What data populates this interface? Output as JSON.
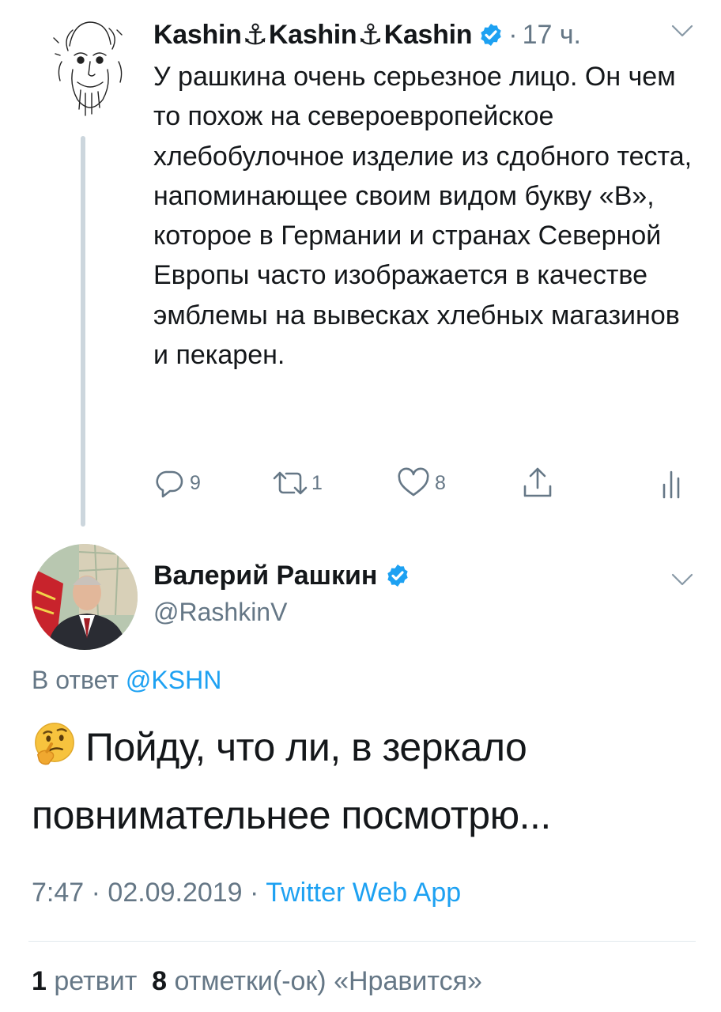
{
  "parent_tweet": {
    "author_name": "Kashin",
    "anchor_glyph": "⚓",
    "time": "17 ч.",
    "text": "У рашкина очень серьезное лицо. Он чем то похож на североевропейское хлебобулочное изделие из сдобного теста, напоминающее своим видом букву «В», которое в Германии и странах Северной Европы часто изображается в качестве эмблемы на вывесках хлебных магазинов и пекарен.",
    "replies_count": "9",
    "retweets_count": "1",
    "likes_count": "8"
  },
  "reply_tweet": {
    "author_name": "Валерий Рашкин",
    "handle": "@RashkinV",
    "reply_prefix": "В ответ",
    "reply_to": "@KSHN",
    "text": "Пойду, что ли, в зеркало повнимательнее посмотрю...",
    "time": "7:47",
    "date": "02.09.2019",
    "source": "Twitter Web App",
    "separator": "·",
    "retweets_num": "1",
    "retweets_label": "ретвит",
    "likes_num": "8",
    "likes_label": "отметки(-ок) «Нравится»"
  },
  "colors": {
    "link": "#1da1f2",
    "secondary_text": "#657786",
    "thread_line": "#ccd6dd",
    "verified": "#1da1f2"
  },
  "icons": [
    "verified-badge-icon",
    "chevron-down-icon",
    "reply-icon",
    "retweet-icon",
    "like-icon",
    "share-icon",
    "analytics-icon",
    "thinking-face-emoji"
  ]
}
